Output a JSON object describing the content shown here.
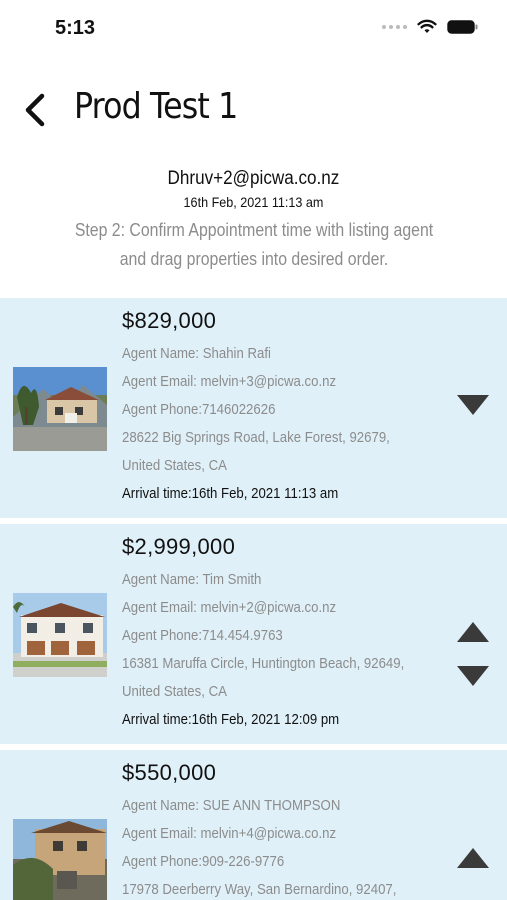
{
  "status_bar": {
    "time": "5:13"
  },
  "nav": {
    "title": "Prod Test 1"
  },
  "header": {
    "email": "Dhruv+2@picwa.co.nz",
    "date": "16th Feb, 2021 11:13 am",
    "step": "Step 2: Confirm Appointment time with listing agent and drag properties into desired order."
  },
  "properties": [
    {
      "price": "$829,000",
      "agent_name": "Agent Name: Shahin Rafi",
      "agent_email": "Agent Email: melvin+3@picwa.co.nz",
      "agent_phone": "Agent Phone:7146022626",
      "address_line1": "28622 Big Springs Road, Lake Forest, 92679,",
      "address_line2": "United States, CA",
      "arrival": "Arrival time:16th Feb, 2021  11:13 am"
    },
    {
      "price": "$2,999,000",
      "agent_name": "Agent Name: Tim Smith",
      "agent_email": "Agent Email: melvin+2@picwa.co.nz",
      "agent_phone": "Agent Phone:714.454.9763",
      "address_line1": "16381 Maruffa Circle, Huntington Beach, 92649,",
      "address_line2": "United States, CA",
      "arrival": "Arrival time:16th Feb, 2021  12:09 pm"
    },
    {
      "price": "$550,000",
      "agent_name": "Agent Name: SUE ANN THOMPSON",
      "agent_email": "Agent Email: melvin+4@picwa.co.nz",
      "agent_phone": "Agent Phone:909-226-9776",
      "address_line1": "17978 Deerberry Way, San Bernardino, 92407,"
    }
  ],
  "colors": {
    "card_bg": "#dff0f8",
    "muted_text": "#8c8c8c",
    "arrow": "#3a3a3a"
  }
}
